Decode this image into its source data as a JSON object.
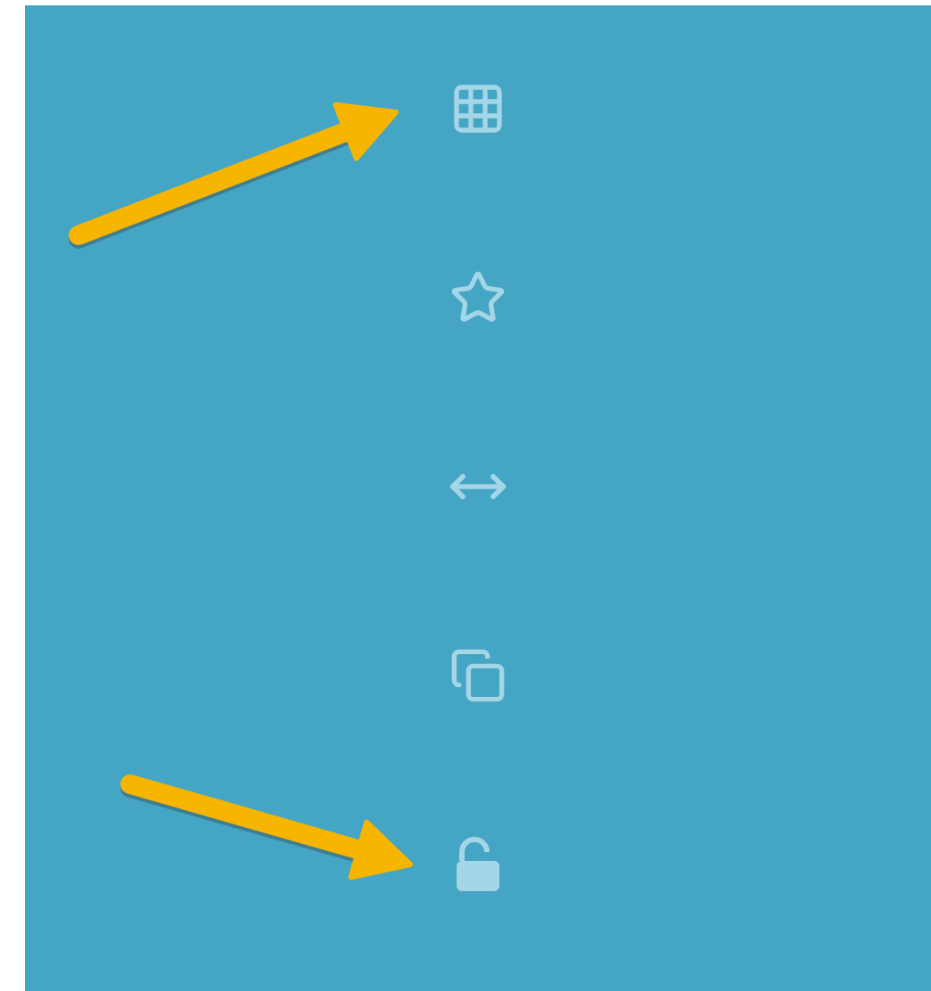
{
  "toolbar": {
    "items": [
      {
        "kind": "grid"
      },
      {
        "kind": "star"
      },
      {
        "kind": "resize"
      },
      {
        "kind": "copy"
      },
      {
        "kind": "unlock"
      }
    ]
  },
  "annotations": [
    {
      "kind": "arrow"
    },
    {
      "kind": "arrow"
    }
  ]
}
